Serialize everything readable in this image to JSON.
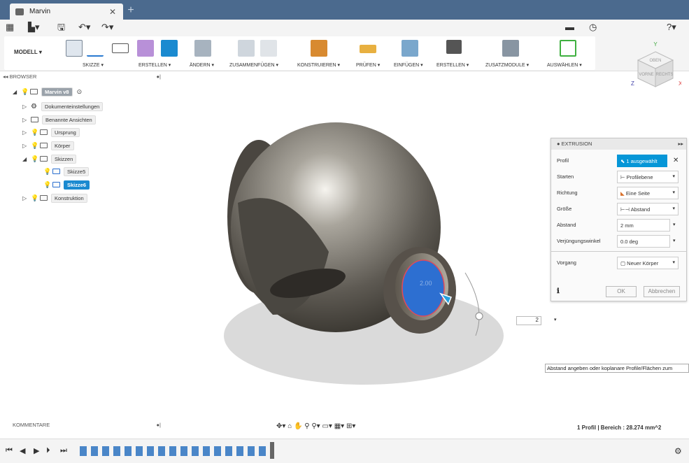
{
  "tab": {
    "title": "Marvin",
    "close": "✕",
    "new": "+"
  },
  "ribbon": {
    "modell": "MODELL ▾",
    "groups": [
      "SKIZZE ▾",
      "ERSTELLEN ▾",
      "ÄNDERN ▾",
      "ZUSAMMENFÜGEN ▾",
      "KONSTRUIEREN ▾",
      "PRÜFEN ▾",
      "EINFÜGEN ▾",
      "ERSTELLEN ▾",
      "ZUSATZMODULE ▾",
      "AUSWÄHLEN ▾"
    ]
  },
  "viewcube": {
    "top": "OBEN",
    "front": "VORNE",
    "right": "RECHTS",
    "x": "X",
    "y": "Y",
    "z": "Z"
  },
  "browser": {
    "title": "BROWSER",
    "root": "Marvin v8",
    "items": [
      "Dokumenteinstellungen",
      "Benannte Ansichten",
      "Ursprung",
      "Körper",
      "Skizzen",
      "Skizze5",
      "Skizze6",
      "Konstruktion"
    ]
  },
  "extrusion": {
    "title": "EXTRUSION",
    "rows": [
      {
        "label": "Profil",
        "value": "1 ausgewählt"
      },
      {
        "label": "Starten",
        "value": "Profilebene"
      },
      {
        "label": "Richtung",
        "value": "Eine Seite"
      },
      {
        "label": "Größe",
        "value": "Abstand"
      },
      {
        "label": "Abstand",
        "value": "2 mm"
      },
      {
        "label": "Verjüngungswinkel",
        "value": "0.0 deg"
      },
      {
        "label": "Vorgang",
        "value": "Neuer Körper"
      }
    ],
    "ok": "OK",
    "cancel": "Abbrechen"
  },
  "canvas": {
    "distance_value": "2",
    "dim_label": "2.00"
  },
  "tooltip": "Abstand angeben oder koplanare Profile/Flächen zum",
  "comments": "KOMMENTARE",
  "status": "1 Profil | Bereich : 28.274 mm^2",
  "colors": {
    "titlebar": "#4b6a8e",
    "accent": "#0696d7",
    "selection_blue": "#2d6fd1",
    "body_gray": "#6e6a63"
  }
}
